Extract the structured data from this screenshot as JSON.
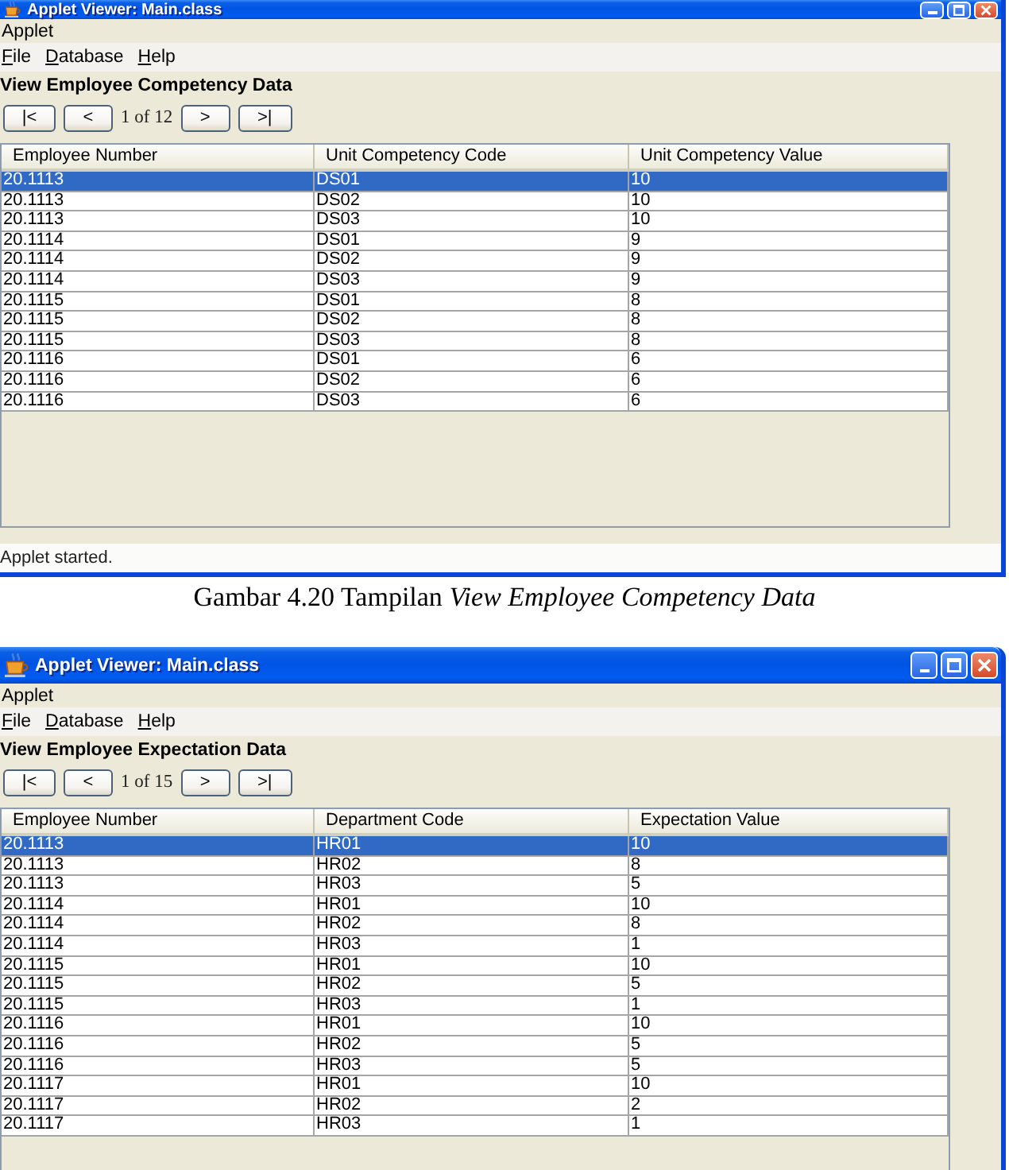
{
  "figures": [
    {
      "window": {
        "title": "Applet Viewer: Main.class",
        "cropped_top": true,
        "applet_menu": "Applet",
        "menu": [
          "File",
          "Database",
          "Help"
        ],
        "heading": "View Employee Competency Data",
        "navigation": [
          {
            "kind": "first",
            "label": "|<"
          },
          {
            "kind": "previous",
            "label": "<"
          },
          {
            "kind": "page",
            "label": "1 of 12"
          },
          {
            "kind": "next",
            "label": ">"
          },
          {
            "kind": "last",
            "label": ">|"
          }
        ],
        "table": {
          "columns": [
            "Employee Number",
            "Unit Competency Code",
            "Unit Competency Value"
          ],
          "rows": [
            {
              "cells": [
                "20.1113",
                "DS01",
                "10"
              ],
              "selected": true
            },
            {
              "cells": [
                "20.1113",
                "DS02",
                "10"
              ],
              "selected": false
            },
            {
              "cells": [
                "20.1113",
                "DS03",
                "10"
              ],
              "selected": false
            },
            {
              "cells": [
                "20.1114",
                "DS01",
                "9"
              ],
              "selected": false
            },
            {
              "cells": [
                "20.1114",
                "DS02",
                "9"
              ],
              "selected": false
            },
            {
              "cells": [
                "20.1114",
                "DS03",
                "9"
              ],
              "selected": false
            },
            {
              "cells": [
                "20.1115",
                "DS01",
                "8"
              ],
              "selected": false
            },
            {
              "cells": [
                "20.1115",
                "DS02",
                "8"
              ],
              "selected": false
            },
            {
              "cells": [
                "20.1115",
                "DS03",
                "8"
              ],
              "selected": false
            },
            {
              "cells": [
                "20.1116",
                "DS01",
                "6"
              ],
              "selected": false
            },
            {
              "cells": [
                "20.1116",
                "DS02",
                "6"
              ],
              "selected": false
            },
            {
              "cells": [
                "20.1116",
                "DS03",
                "6"
              ],
              "selected": false
            }
          ]
        },
        "status_bar": "Applet started."
      },
      "caption": "Gambar 4.20 Tampilan *View Employee Competency Data*"
    },
    {
      "window": {
        "title": "Applet Viewer: Main.class",
        "cropped_top": false,
        "applet_menu": "Applet",
        "menu": [
          "File",
          "Database",
          "Help"
        ],
        "heading": "View Employee Expectation Data",
        "navigation": [
          {
            "kind": "first",
            "label": "|<"
          },
          {
            "kind": "previous",
            "label": "<"
          },
          {
            "kind": "page",
            "label": "1 of 15"
          },
          {
            "kind": "next",
            "label": ">"
          },
          {
            "kind": "last",
            "label": ">|"
          }
        ],
        "table": {
          "columns": [
            "Employee Number",
            "Department Code",
            "Expectation Value"
          ],
          "rows": [
            {
              "cells": [
                "20.1113",
                "HR01",
                "10"
              ],
              "selected": true
            },
            {
              "cells": [
                "20.1113",
                "HR02",
                "8"
              ],
              "selected": false
            },
            {
              "cells": [
                "20.1113",
                "HR03",
                "5"
              ],
              "selected": false
            },
            {
              "cells": [
                "20.1114",
                "HR01",
                "10"
              ],
              "selected": false
            },
            {
              "cells": [
                "20.1114",
                "HR02",
                "8"
              ],
              "selected": false
            },
            {
              "cells": [
                "20.1114",
                "HR03",
                "1"
              ],
              "selected": false
            },
            {
              "cells": [
                "20.1115",
                "HR01",
                "10"
              ],
              "selected": false
            },
            {
              "cells": [
                "20.1115",
                "HR02",
                "5"
              ],
              "selected": false
            },
            {
              "cells": [
                "20.1115",
                "HR03",
                "1"
              ],
              "selected": false
            },
            {
              "cells": [
                "20.1116",
                "HR01",
                "10"
              ],
              "selected": false
            },
            {
              "cells": [
                "20.1116",
                "HR02",
                "5"
              ],
              "selected": false
            },
            {
              "cells": [
                "20.1116",
                "HR03",
                "5"
              ],
              "selected": false
            },
            {
              "cells": [
                "20.1117",
                "HR01",
                "10"
              ],
              "selected": false
            },
            {
              "cells": [
                "20.1117",
                "HR02",
                "2"
              ],
              "selected": false
            },
            {
              "cells": [
                "20.1117",
                "HR03",
                "1"
              ],
              "selected": false
            }
          ]
        }
      }
    }
  ]
}
